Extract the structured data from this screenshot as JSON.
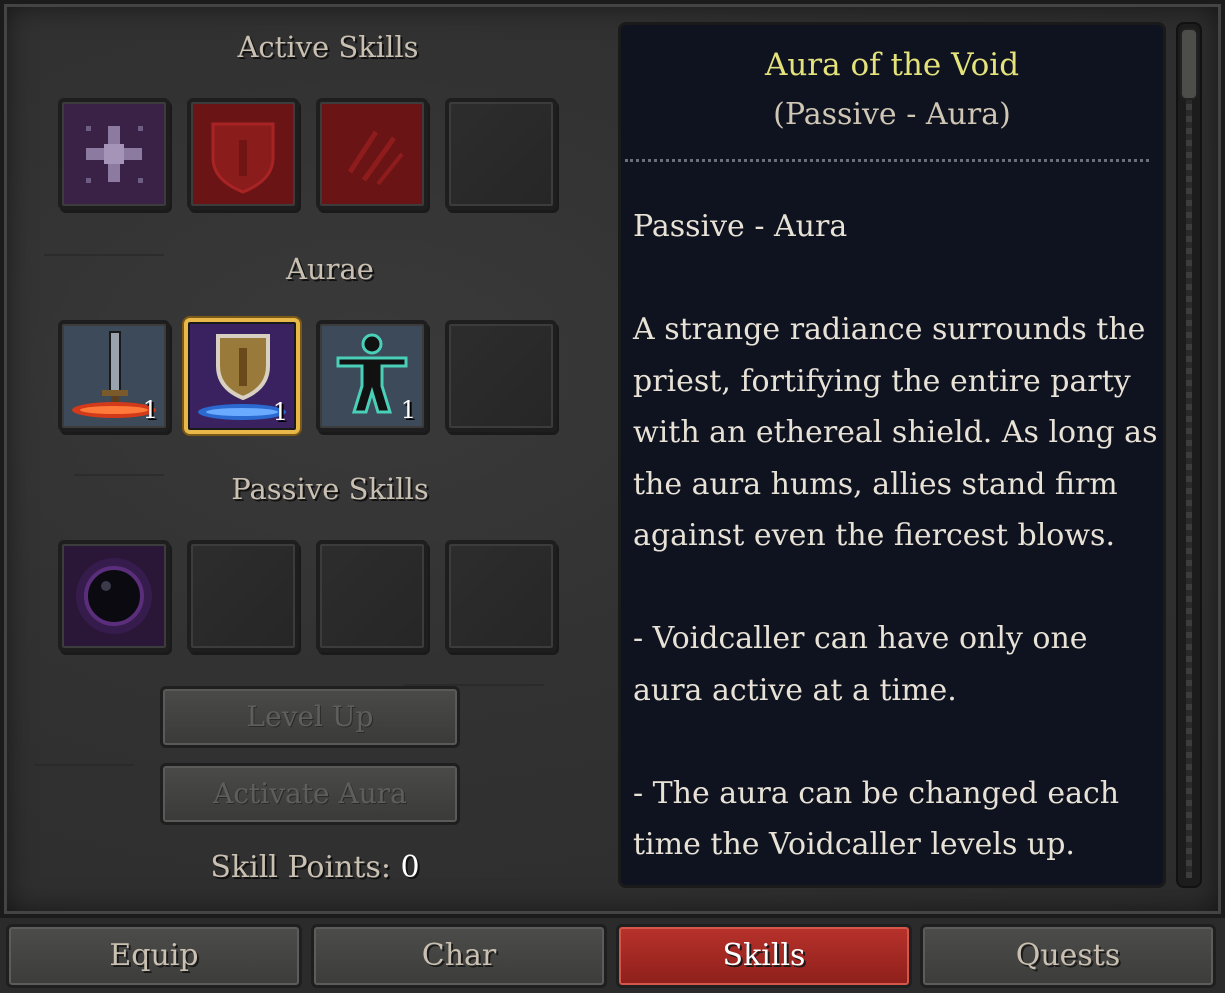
{
  "sections": {
    "active_title": "Active Skills",
    "aurae_title": "Aurae",
    "passive_title": "Passive Skills"
  },
  "active_slots": [
    {
      "icon": "sparkle-icon",
      "color": "#3a2247"
    },
    {
      "icon": "shield-icon",
      "color": "#6a1416"
    },
    {
      "icon": "slash-icon",
      "color": "#6a1416"
    },
    {
      "icon": "empty-slot",
      "color": "#2b2b2b"
    }
  ],
  "aura_slots": [
    {
      "icon": "sword-aura-icon",
      "count": "1"
    },
    {
      "icon": "shield-aura-icon",
      "count": "1",
      "selected": true
    },
    {
      "icon": "figure-aura-icon",
      "count": "1"
    },
    {
      "icon": "empty-slot"
    }
  ],
  "passive_slots": [
    {
      "icon": "void-orb-icon"
    },
    {
      "icon": "empty-slot"
    },
    {
      "icon": "empty-slot"
    },
    {
      "icon": "empty-slot"
    }
  ],
  "buttons": {
    "level_up": "Level Up",
    "activate_aura": "Activate Aura"
  },
  "skill_points": {
    "label": "Skill Points:",
    "value": "0"
  },
  "detail": {
    "title": "Aura of the Void",
    "subtitle": "(Passive - Aura)",
    "type_line": "Passive - Aura",
    "description": "A strange radiance surrounds the priest, fortifying the entire party with an ethereal shield. As long as the aura hums, allies stand firm against even the fiercest blows.",
    "note1": "- Voidcaller can have only one aura active at a time.",
    "note2": "- The aura can be changed each time the Voidcaller levels up."
  },
  "tabs": {
    "equip": "Equip",
    "char": "Char",
    "skills": "Skills",
    "quests": "Quests",
    "active": "Skills"
  },
  "colors": {
    "title_yellow": "#e4e27a",
    "selected_border": "#e8b84a",
    "active_tab": "#b8322b",
    "panel_bg": "#0f1320"
  }
}
